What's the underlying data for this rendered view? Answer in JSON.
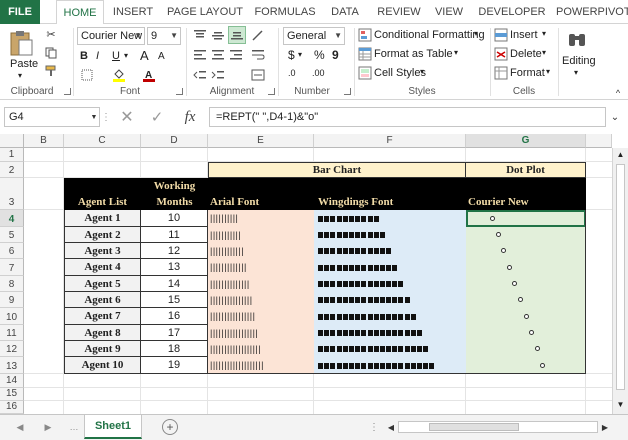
{
  "tabs": [
    "FILE",
    "HOME",
    "INSERT",
    "PAGE LAYOUT",
    "FORMULAS",
    "DATA",
    "REVIEW",
    "VIEW",
    "DEVELOPER",
    "POWERPIVOT"
  ],
  "ribbon": {
    "clipboard": {
      "label": "Clipboard",
      "paste": "Paste"
    },
    "font": {
      "label": "Font",
      "name": "Courier New",
      "size": "9",
      "bold": "B",
      "italic": "I",
      "underline": "U",
      "grow": "A",
      "shrink": "A"
    },
    "alignment": {
      "label": "Alignment"
    },
    "number": {
      "label": "Number",
      "format": "General",
      "currency": "$",
      "percent": "%",
      "comma": "9",
      "inc_decimal": ".0",
      "dec_decimal": ".00"
    },
    "styles": {
      "label": "Styles",
      "conditional": "Conditional Formatting",
      "table": "Format as Table",
      "cell_styles": "Cell Styles"
    },
    "cells": {
      "label": "Cells",
      "insert": "Insert",
      "delete": "Delete",
      "format": "Format"
    },
    "editing": {
      "label": "Editing"
    }
  },
  "formula_bar": {
    "name_box": "G4",
    "fx": "fx",
    "formula": "=REPT(\" \",D4-1)&\"o\""
  },
  "columns": [
    "B",
    "C",
    "D",
    "E",
    "F",
    "G"
  ],
  "rows": [
    "1",
    "2",
    "3",
    "4",
    "5",
    "6",
    "7",
    "8",
    "9",
    "10",
    "11",
    "12",
    "13",
    "14",
    "15",
    "16"
  ],
  "table": {
    "bar_chart_title": "Bar Chart",
    "dot_plot_title": "Dot Plot",
    "agent_list_header": "Agent List",
    "working_months_header_1": "Working",
    "working_months_header_2": "Months",
    "arial_header": "Arial Font",
    "wingdings_header": "Wingdings Font",
    "courier_header": "Courier New",
    "agents": [
      "Agent 1",
      "Agent 2",
      "Agent 3",
      "Agent 4",
      "Agent 5",
      "Agent 6",
      "Agent 7",
      "Agent 8",
      "Agent 9",
      "Agent 10"
    ],
    "months": [
      "10",
      "11",
      "12",
      "13",
      "14",
      "15",
      "16",
      "17",
      "18",
      "19"
    ],
    "arial_bars": [
      "||||||||||",
      "|||||||||||",
      "||||||||||||",
      "|||||||||||||",
      "||||||||||||||",
      "|||||||||||||||",
      "||||||||||||||||",
      "|||||||||||||||||",
      "||||||||||||||||||",
      "|||||||||||||||||||"
    ]
  },
  "colors": {
    "excel_green": "#217346",
    "bar_header_bg": "#fff2cc",
    "arial_bg": "#fce4d6",
    "wingdings_bg": "#ddebf7",
    "courier_bg": "#e2efda",
    "header_black": "#000000",
    "agent_bg": "#f2f2f2"
  },
  "sheet": {
    "name": "Sheet1",
    "add_icon": "plus-icon"
  }
}
